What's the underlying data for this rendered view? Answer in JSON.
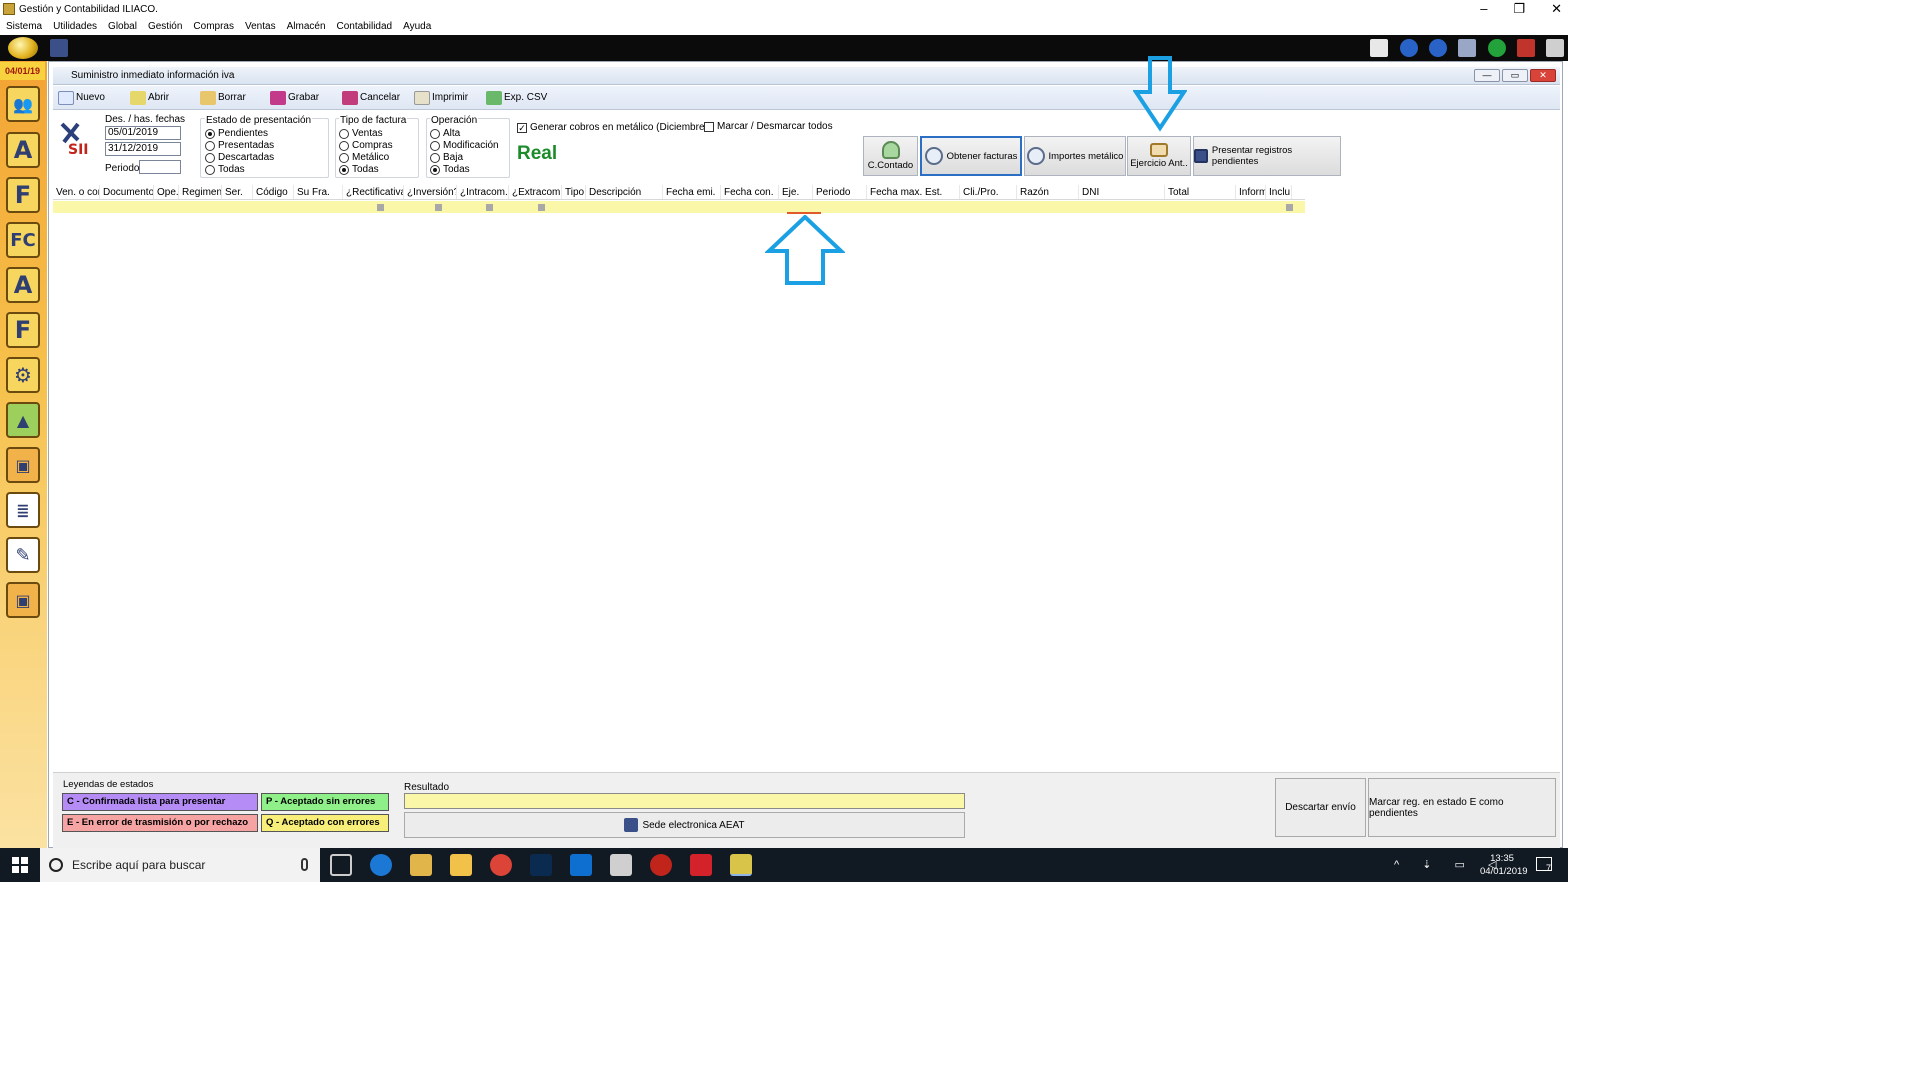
{
  "window": {
    "title": "Gestión y Contabilidad ILIACO."
  },
  "menu": [
    "Sistema",
    "Utilidades",
    "Global",
    "Gestión",
    "Compras",
    "Ventas",
    "Almacén",
    "Contabilidad",
    "Ayuda"
  ],
  "sidebar": {
    "date": "04/01/19",
    "icons": [
      "users-icon",
      "A",
      "F",
      "FC",
      "A",
      "F",
      "gear-icon",
      "bag-icon",
      "box-icon",
      "list-icon",
      "pencil-icon",
      "box-icon"
    ]
  },
  "subwindow": {
    "title": "Suministro inmediato información iva"
  },
  "toolbar": {
    "nuevo": "Nuevo",
    "abrir": "Abrir",
    "borrar": "Borrar",
    "grabar": "Grabar",
    "cancelar": "Cancelar",
    "imprimir": "Imprimir",
    "exp_csv": "Exp. CSV"
  },
  "filters": {
    "fechas_label": "Des. / has. fechas",
    "fecha_desde": "05/01/2019",
    "fecha_hasta": "31/12/2019",
    "periodo_label": "Periodo",
    "periodo_value": "",
    "estado": {
      "label": "Estado de presentación",
      "options": [
        "Pendientes",
        "Presentadas",
        "Descartadas",
        "Todas"
      ],
      "selected": "Pendientes"
    },
    "tipo": {
      "label": "Tipo de factura",
      "options": [
        "Ventas",
        "Compras",
        "Metálico",
        "Todas"
      ],
      "selected": "Todas"
    },
    "operacion": {
      "label": "Operación",
      "options": [
        "Alta",
        "Modificación",
        "Baja",
        "Todas"
      ],
      "selected": "Todas"
    },
    "generar_cobros": {
      "label": "Generar cobros en metálico (Diciembre)",
      "checked": true
    },
    "marcar_todos": {
      "label": "Marcar / Desmarcar todos",
      "checked": false
    },
    "modo": "Real"
  },
  "actions": {
    "contado": "C.Contado",
    "obtener": "Obtener facturas",
    "importes": "Importes metálico",
    "ejercicio": "Ejercicio Ant..",
    "presentar": "Presentar registros pendientes"
  },
  "grid": {
    "columns": [
      "Ven. o com.",
      "Documento",
      "Ope.",
      "Regimen",
      "Ser.",
      "Código",
      "Su Fra.",
      "¿Rectificativa?",
      "¿Inversión?",
      "¿Intracom.?",
      "¿Extracom.?",
      "Tipo",
      "Descripción",
      "Fecha emi.",
      "Fecha con.",
      "Eje.",
      "Periodo",
      "Fecha max. Est.",
      "Cli./Pro.",
      "Razón",
      "DNI",
      "Total",
      "Informa",
      "Inclu."
    ]
  },
  "bottom": {
    "leyendas_label": "Leyendas de estados",
    "legend": [
      {
        "text": "C - Confirmada lista para presentar",
        "color": "#b58cf5"
      },
      {
        "text": "P - Aceptado sin errores",
        "color": "#8ff08a"
      },
      {
        "text": "E - En error de trasmisión o por rechazo",
        "color": "#f5a3a3"
      },
      {
        "text": "Q - Aceptado con errores",
        "color": "#f7ef7a"
      }
    ],
    "resultado_label": "Resultado",
    "resultado_value": "",
    "sede": "Sede electronica AEAT",
    "descartar": "Descartar envío",
    "marcar_pendientes": "Marcar reg. en estado E como pendientes"
  },
  "taskbar": {
    "search_placeholder": "Escribe aquí para buscar",
    "time": "13:35",
    "date": "04/01/2019",
    "notifications": "7"
  },
  "colors": {
    "accent_arrow": "#1aa0e3",
    "real_green": "#1c8c2b",
    "row_yellow": "#fbf7a9"
  }
}
